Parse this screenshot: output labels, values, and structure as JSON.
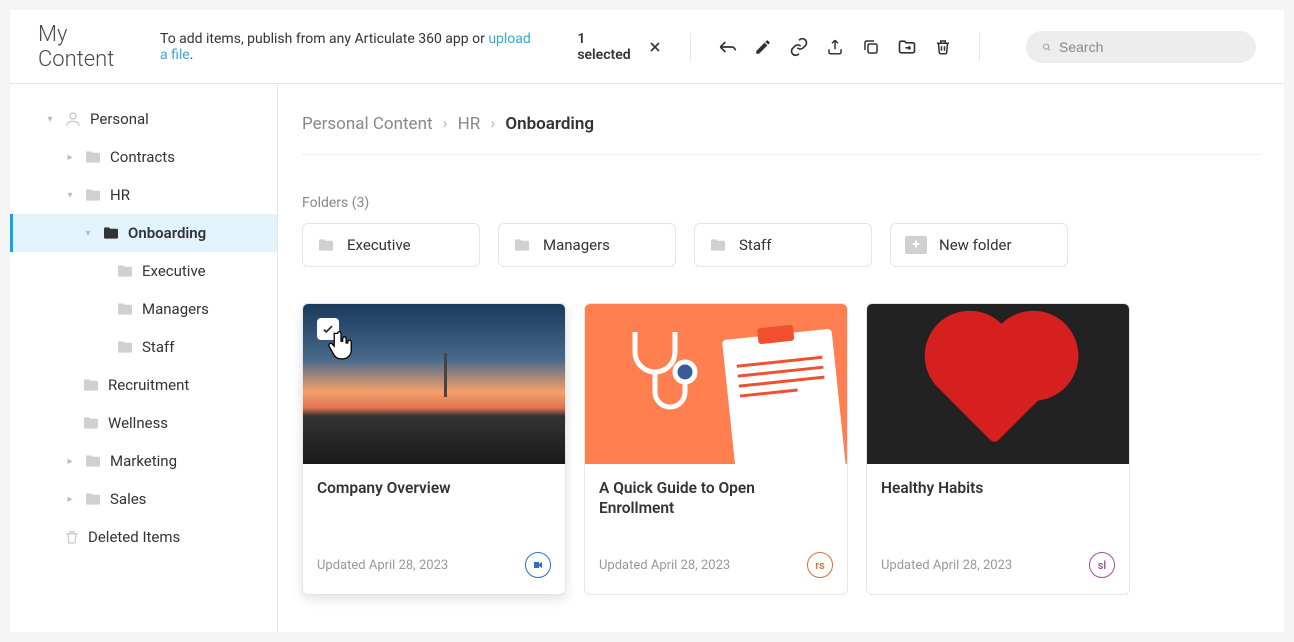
{
  "header": {
    "title": "My Content",
    "subtitle_prefix": "To add items, publish from any Articulate 360 app or ",
    "subtitle_link": "upload a file",
    "subtitle_suffix": ".",
    "selection_text": "1 selected",
    "search_placeholder": "Search"
  },
  "sidebar": {
    "root": "Personal",
    "items": [
      {
        "label": "Contracts"
      },
      {
        "label": "HR"
      },
      {
        "label": "Onboarding",
        "active": true
      },
      {
        "label": "Executive"
      },
      {
        "label": "Managers"
      },
      {
        "label": "Staff"
      },
      {
        "label": "Recruitment"
      },
      {
        "label": "Wellness"
      },
      {
        "label": "Marketing"
      },
      {
        "label": "Sales"
      }
    ],
    "deleted": "Deleted Items"
  },
  "breadcrumb": {
    "a": "Personal Content",
    "b": "HR",
    "c": "Onboarding"
  },
  "folders_label": "Folders (3)",
  "folders": {
    "f0": "Executive",
    "f1": "Managers",
    "f2": "Staff",
    "new": "New folder"
  },
  "cards": {
    "c0": {
      "title": "Company Overview",
      "date": "Updated April 28, 2023",
      "badge": "video"
    },
    "c1": {
      "title": "A Quick Guide to Open Enrollment",
      "date": "Updated April 28, 2023",
      "badge": "rs"
    },
    "c2": {
      "title": "Healthy Habits",
      "date": "Updated April 28, 2023",
      "badge": "sl"
    }
  }
}
